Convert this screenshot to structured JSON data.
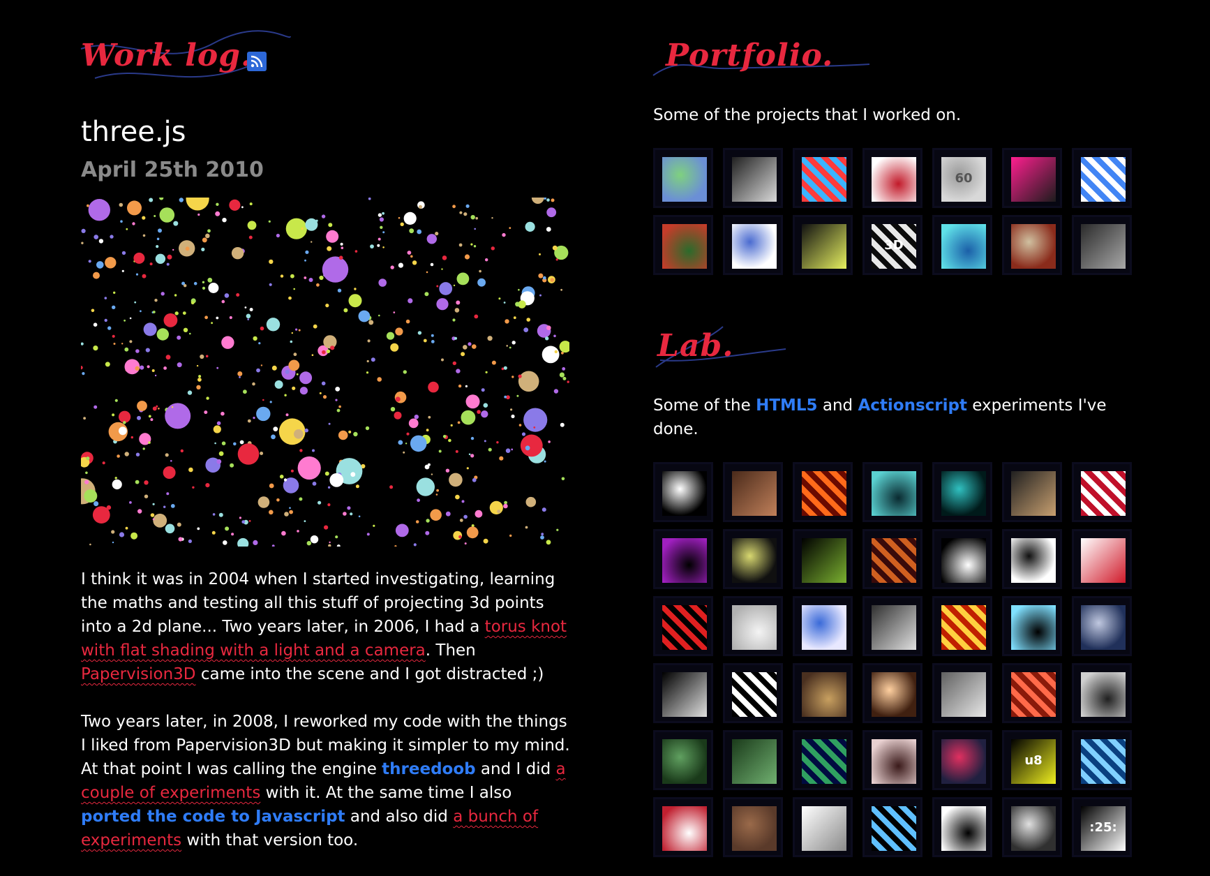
{
  "worklog": {
    "heading": "Work log.",
    "rss_icon": "rss-icon",
    "post_title": "three.js",
    "post_date": "April 25th 2010",
    "paragraph1": {
      "t1": "I think it was in 2004 when I started investigating, learning the maths and testing all this stuff of projecting 3d points into a 2d plane... Two years later, in 2006, I had a ",
      "link1": "torus knot with flat shading with a light and a camera",
      "t2": ". Then ",
      "link2": "Papervision3D",
      "t3": " came into the scene and I got distracted ;)"
    },
    "paragraph2": {
      "t1": "Two years later, in 2008, I reworked my code with the things I liked from Papervision3D but making it simpler to my mind. At that point I was calling the engine ",
      "link1": "threedoob",
      "t2": " and I did ",
      "link2": "a couple of experiments",
      "t3": " with it. At the same time I also ",
      "link3": "ported the code to Javascript",
      "t4": " and also did ",
      "link4": "a bunch of experiments",
      "t5": " with that version too."
    }
  },
  "portfolio": {
    "heading": "Portfolio.",
    "intro": "Some of the projects that I worked on.",
    "thumbs": [
      {
        "name": "portfolio-thumb-1",
        "c1": "#6b8fd6",
        "c2": "#7fd17f"
      },
      {
        "name": "portfolio-thumb-2",
        "c1": "#202020",
        "c2": "#d9d9d9"
      },
      {
        "name": "portfolio-thumb-3",
        "c1": "#ff3b3b",
        "c2": "#3bb4ff"
      },
      {
        "name": "portfolio-thumb-4",
        "c1": "#c21a2a",
        "c2": "#ffffff"
      },
      {
        "name": "portfolio-thumb-5",
        "c1": "#d8d8d8",
        "c2": "#9a9a9a",
        "label": "60"
      },
      {
        "name": "portfolio-thumb-6",
        "c1": "#ff1f8f",
        "c2": "#1c1c1c"
      },
      {
        "name": "portfolio-thumb-7",
        "c1": "#ffffff",
        "c2": "#4285f4"
      },
      {
        "name": "portfolio-thumb-8",
        "c1": "#2b6b2b",
        "c2": "#c43c2a"
      },
      {
        "name": "portfolio-thumb-9",
        "c1": "#ffffff",
        "c2": "#4a6bd0"
      },
      {
        "name": "portfolio-thumb-10",
        "c1": "#111111",
        "c2": "#e6f060"
      },
      {
        "name": "portfolio-thumb-11",
        "c1": "#0b0b0b",
        "c2": "#e8e8e8",
        "label": "3D"
      },
      {
        "name": "portfolio-thumb-12",
        "c1": "#1b5fa8",
        "c2": "#5fe0e8"
      },
      {
        "name": "portfolio-thumb-13",
        "c1": "#8a2b1b",
        "c2": "#d0c0a0"
      },
      {
        "name": "portfolio-thumb-14",
        "c1": "#2a2a2a",
        "c2": "#a8a8a8"
      }
    ]
  },
  "lab": {
    "heading": "Lab.",
    "intro_t1": "Some of the ",
    "intro_link1": "HTML5",
    "intro_t2": " and ",
    "intro_link2": "Actionscript",
    "intro_t3": " experiments I've done.",
    "thumbs": [
      {
        "name": "lab-thumb-1",
        "c1": "#000000",
        "c2": "#ffffff"
      },
      {
        "name": "lab-thumb-2",
        "c1": "#4a2a1a",
        "c2": "#c0805a"
      },
      {
        "name": "lab-thumb-3",
        "c1": "#6a0a00",
        "c2": "#ff6a1a"
      },
      {
        "name": "lab-thumb-4",
        "c1": "#0a2a30",
        "c2": "#5ad0d0"
      },
      {
        "name": "lab-thumb-5",
        "c1": "#001a1a",
        "c2": "#30c0c0"
      },
      {
        "name": "lab-thumb-6",
        "c1": "#202020",
        "c2": "#c8a070"
      },
      {
        "name": "lab-thumb-7",
        "c1": "#c0102a",
        "c2": "#ffffff"
      },
      {
        "name": "lab-thumb-8",
        "c1": "#000000",
        "c2": "#a020c0"
      },
      {
        "name": "lab-thumb-9",
        "c1": "#101010",
        "c2": "#d8d870"
      },
      {
        "name": "lab-thumb-10",
        "c1": "#000000",
        "c2": "#7ab030"
      },
      {
        "name": "lab-thumb-11",
        "c1": "#3a0a0a",
        "c2": "#d06020"
      },
      {
        "name": "lab-thumb-12",
        "c1": "#ffffff",
        "c2": "#000000"
      },
      {
        "name": "lab-thumb-13",
        "c1": "#ffffff",
        "c2": "#101010"
      },
      {
        "name": "lab-thumb-14",
        "c1": "#ffffff",
        "c2": "#d01a2a"
      },
      {
        "name": "lab-thumb-15",
        "c1": "#000000",
        "c2": "#e02020"
      },
      {
        "name": "lab-thumb-16",
        "c1": "#f4f4f4",
        "c2": "#b0b0b0"
      },
      {
        "name": "lab-thumb-17",
        "c1": "#e8e8ff",
        "c2": "#3a6ad8"
      },
      {
        "name": "lab-thumb-18",
        "c1": "#303030",
        "c2": "#e0e0e0"
      },
      {
        "name": "lab-thumb-19",
        "c1": "#c02000",
        "c2": "#ffd040"
      },
      {
        "name": "lab-thumb-20",
        "c1": "#000000",
        "c2": "#80e0ff"
      },
      {
        "name": "lab-thumb-21",
        "c1": "#20305a",
        "c2": "#c0c8e0"
      },
      {
        "name": "lab-thumb-22",
        "c1": "#000000",
        "c2": "#e0e0e0"
      },
      {
        "name": "lab-thumb-23",
        "c1": "#000000",
        "c2": "#ffffff"
      },
      {
        "name": "lab-thumb-24",
        "c1": "#c8a060",
        "c2": "#4a3020"
      },
      {
        "name": "lab-thumb-25",
        "c1": "#402010",
        "c2": "#ffd0a0"
      },
      {
        "name": "lab-thumb-26",
        "c1": "#606060",
        "c2": "#e8e8e8"
      },
      {
        "name": "lab-thumb-27",
        "c1": "#8a1a0a",
        "c2": "#ff6a4a"
      },
      {
        "name": "lab-thumb-28",
        "c1": "#202020",
        "c2": "#d0d0d0"
      },
      {
        "name": "lab-thumb-29",
        "c1": "#1a3a1a",
        "c2": "#60a060"
      },
      {
        "name": "lab-thumb-30",
        "c1": "#1a3a1a",
        "c2": "#70b070"
      },
      {
        "name": "lab-thumb-31",
        "c1": "#000a40",
        "c2": "#30a060"
      },
      {
        "name": "lab-thumb-32",
        "c1": "#3a1a1a",
        "c2": "#e8d0d0"
      },
      {
        "name": "lab-thumb-33",
        "c1": "#202040",
        "c2": "#e03060"
      },
      {
        "name": "lab-thumb-34",
        "c1": "#000000",
        "c2": "#f0f020",
        "label": "u8"
      },
      {
        "name": "lab-thumb-35",
        "c1": "#0a4080",
        "c2": "#80d0ff"
      },
      {
        "name": "lab-thumb-36",
        "c1": "#ffffff",
        "c2": "#c02030"
      },
      {
        "name": "lab-thumb-37",
        "c1": "#5a3a2a",
        "c2": "#9a6a4a"
      },
      {
        "name": "lab-thumb-38",
        "c1": "#ffffff",
        "c2": "#8a8a8a"
      },
      {
        "name": "lab-thumb-39",
        "c1": "#000000",
        "c2": "#60c0ff"
      },
      {
        "name": "lab-thumb-40",
        "c1": "#000000",
        "c2": "#ffffff"
      },
      {
        "name": "lab-thumb-41",
        "c1": "#303030",
        "c2": "#e0e0e0"
      },
      {
        "name": "lab-thumb-42",
        "c1": "#000000",
        "c2": "#ffffff",
        "label": ":25:"
      }
    ]
  },
  "colors": {
    "accent_red": "#e8283f",
    "link_blue": "#2f7cf6",
    "date_gray": "#8a8a8a"
  }
}
